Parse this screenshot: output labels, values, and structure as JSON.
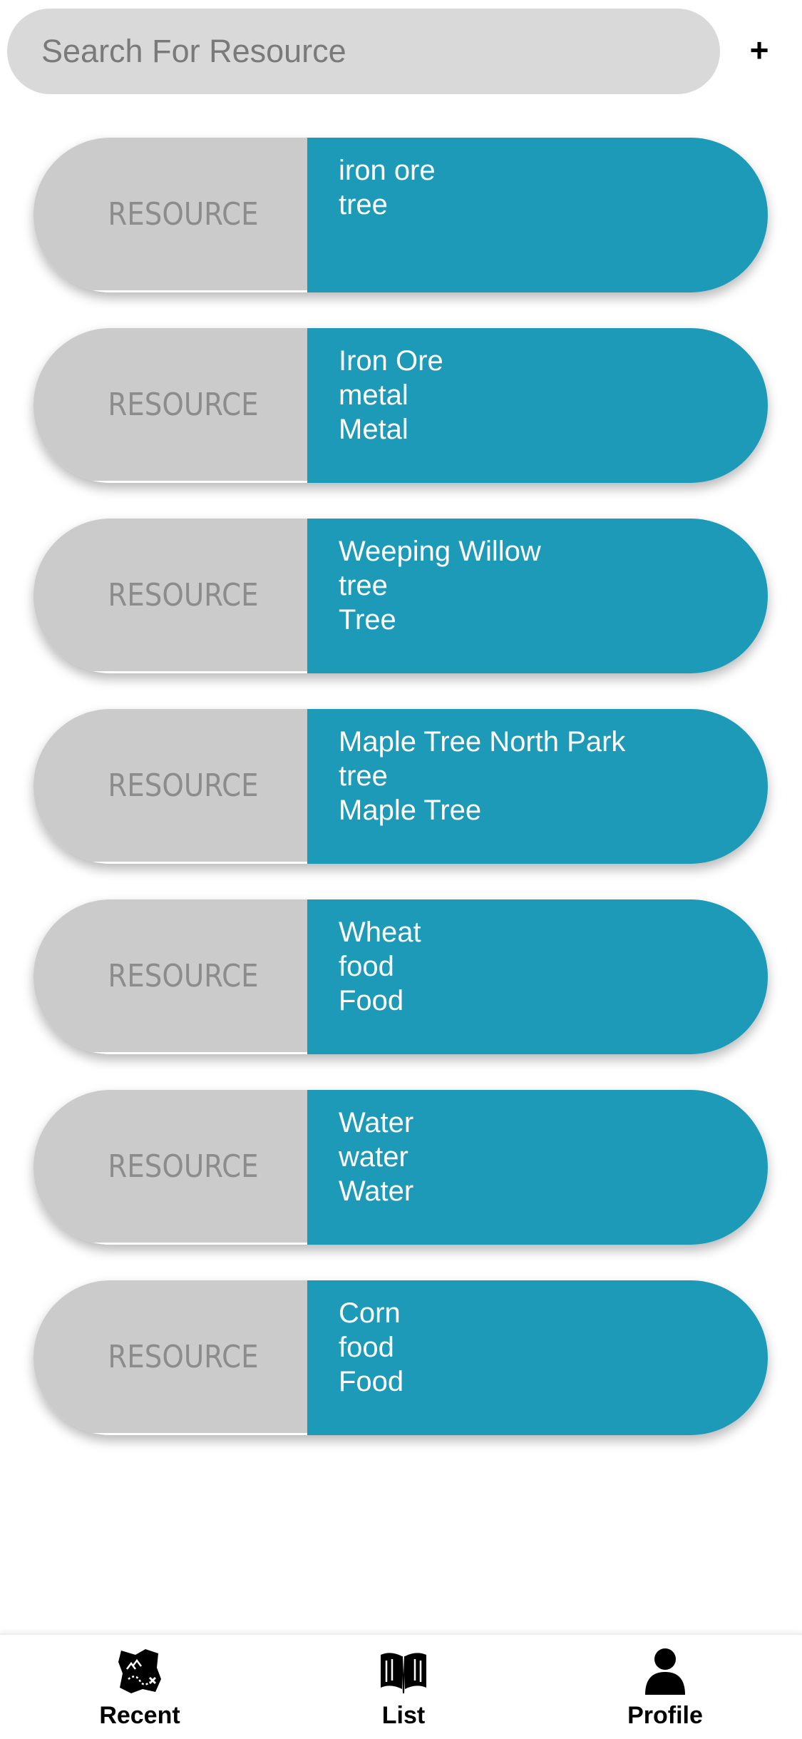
{
  "search": {
    "placeholder": "Search For Resource"
  },
  "add_button_label": "+",
  "resources": [
    {
      "tag": "RESOURCE",
      "lines": [
        "iron ore",
        "tree"
      ]
    },
    {
      "tag": "RESOURCE",
      "lines": [
        "Iron Ore",
        "metal",
        "Metal"
      ]
    },
    {
      "tag": "RESOURCE",
      "lines": [
        "Weeping Willow",
        "tree",
        "Tree"
      ]
    },
    {
      "tag": "RESOURCE",
      "lines": [
        "Maple Tree North Park",
        "tree",
        "Maple Tree"
      ]
    },
    {
      "tag": "RESOURCE",
      "lines": [
        "Wheat",
        "food",
        "Food"
      ]
    },
    {
      "tag": "RESOURCE",
      "lines": [
        "Water",
        "water",
        "Water"
      ]
    },
    {
      "tag": "RESOURCE",
      "lines": [
        "Corn",
        "food",
        "Food"
      ]
    }
  ],
  "nav": {
    "recent": {
      "label": "Recent",
      "icon": "treasure-map-icon"
    },
    "list": {
      "label": "List",
      "icon": "open-book-icon"
    },
    "profile": {
      "label": "Profile",
      "icon": "person-icon"
    }
  },
  "colors": {
    "card_accent": "#1d9ab8",
    "card_tag_bg": "#cbcbcb",
    "search_bg": "#d9d9d9"
  }
}
